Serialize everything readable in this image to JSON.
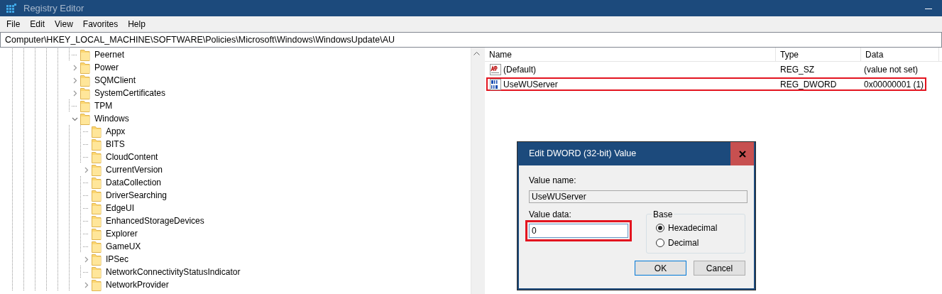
{
  "window": {
    "title": "Registry Editor"
  },
  "menu": [
    "File",
    "Edit",
    "View",
    "Favorites",
    "Help"
  ],
  "address": "Computer\\HKEY_LOCAL_MACHINE\\SOFTWARE\\Policies\\Microsoft\\Windows\\WindowsUpdate\\AU",
  "tree": [
    {
      "label": "Peernet"
    },
    {
      "label": "Power",
      "expanded": false
    },
    {
      "label": "SQMClient",
      "expanded": false
    },
    {
      "label": "SystemCertificates",
      "expanded": false
    },
    {
      "label": "TPM"
    },
    {
      "label": "Windows",
      "expanded": true,
      "children": [
        {
          "label": "Appx"
        },
        {
          "label": "BITS"
        },
        {
          "label": "CloudContent"
        },
        {
          "label": "CurrentVersion",
          "expanded": false
        },
        {
          "label": "DataCollection"
        },
        {
          "label": "DriverSearching"
        },
        {
          "label": "EdgeUI"
        },
        {
          "label": "EnhancedStorageDevices"
        },
        {
          "label": "Explorer"
        },
        {
          "label": "GameUX"
        },
        {
          "label": "IPSec",
          "expanded": false
        },
        {
          "label": "NetworkConnectivityStatusIndicator"
        },
        {
          "label": "NetworkProvider",
          "expanded": false
        }
      ]
    }
  ],
  "values": {
    "columns": [
      "Name",
      "Type",
      "Data"
    ],
    "rows": [
      {
        "kind": "string",
        "name": "(Default)",
        "type": "REG_SZ",
        "data": "(value not set)",
        "highlighted": false
      },
      {
        "kind": "binary",
        "name": "UseWUServer",
        "type": "REG_DWORD",
        "data": "0x00000001 (1)",
        "highlighted": true
      }
    ]
  },
  "dialog": {
    "title": "Edit DWORD (32-bit) Value",
    "value_name_label": {
      "text": "Value name:"
    },
    "value_name": "UseWUServer",
    "value_data_label": {
      "text": "Value data:"
    },
    "value_data": "0",
    "value_data_highlighted": true,
    "base_label": "Base",
    "bases": [
      {
        "label": "Hexadecimal",
        "selected": true
      },
      {
        "label": "Decimal",
        "selected": false
      }
    ],
    "buttons": [
      {
        "label": "OK",
        "default": true
      },
      {
        "label": "Cancel",
        "default": false
      }
    ]
  }
}
